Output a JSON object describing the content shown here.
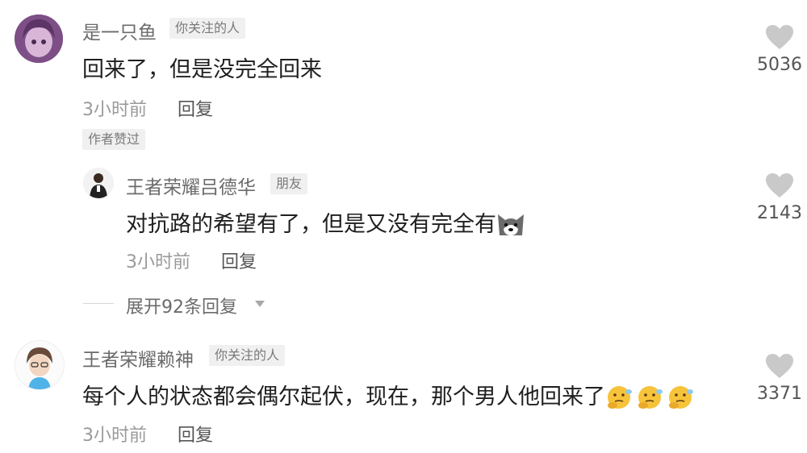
{
  "comments": [
    {
      "user": "是一只鱼",
      "tag": "你关注的人",
      "content": "回来了，但是没完全回来",
      "time": "3小时前",
      "reply_label": "回复",
      "likes": "5036",
      "author_liked": "作者赞过",
      "replies": [
        {
          "user": "王者荣耀吕德华",
          "tag": "朋友",
          "content": "对抗路的希望有了，但是又没有完全有",
          "emoji": "husky-dog-emoji",
          "time": "3小时前",
          "reply_label": "回复",
          "likes": "2143"
        }
      ],
      "expand_label": "展开92条回复"
    },
    {
      "user": "王者荣耀赖神",
      "tag": "你关注的人",
      "content": "每个人的状态都会偶尔起伏，现在，那个男人他回来了",
      "emoji": "thinking-face-emoji",
      "time": "3小时前",
      "reply_label": "回复",
      "likes": "3371"
    }
  ],
  "colors": {
    "heart": "#c9c9c9",
    "name": "#6b6b6b",
    "content": "#1f1f1f"
  }
}
